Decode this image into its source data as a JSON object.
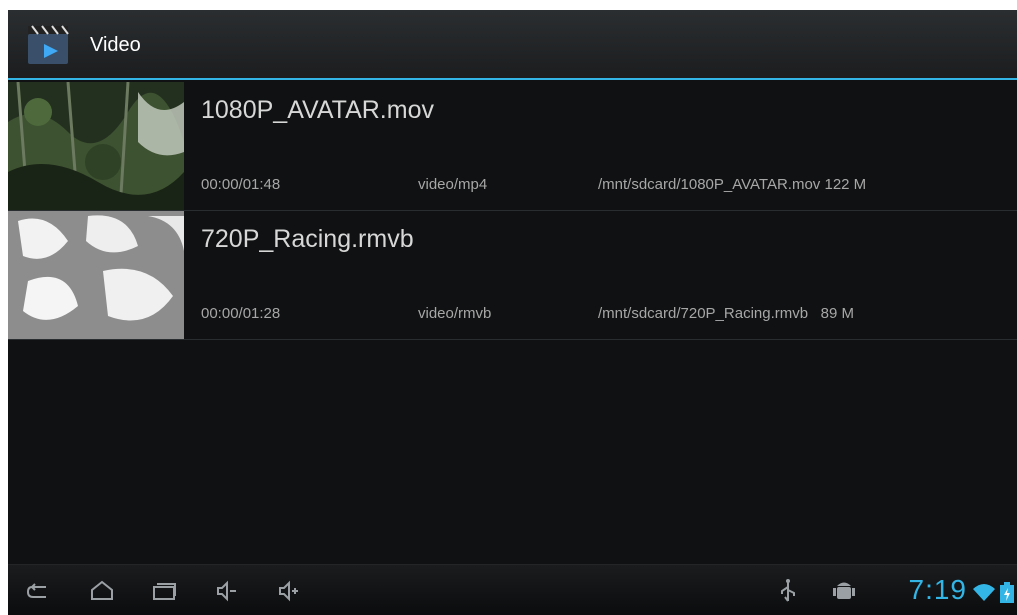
{
  "app": {
    "title": "Video",
    "icon": "clapperboard-icon"
  },
  "videos": [
    {
      "title": "1080P_AVATAR.mov",
      "duration": "00:00/01:48",
      "mime": "video/mp4",
      "path": "/mnt/sdcard/1080P_AVATAR.mov",
      "size": "122 M"
    },
    {
      "title": "720P_Racing.rmvb",
      "duration": "00:00/01:28",
      "mime": "video/rmvb",
      "path": "/mnt/sdcard/720P_Racing.rmvb",
      "size": "89 M"
    }
  ],
  "system_bar": {
    "clock": "7:19",
    "accent_color": "#33b5e5",
    "buttons": [
      "back-icon",
      "home-icon",
      "recent-apps-icon",
      "volume-down-icon",
      "volume-up-icon"
    ],
    "status_icons": [
      "usb-icon",
      "android-debug-icon",
      "wifi-icon",
      "battery-icon"
    ]
  }
}
